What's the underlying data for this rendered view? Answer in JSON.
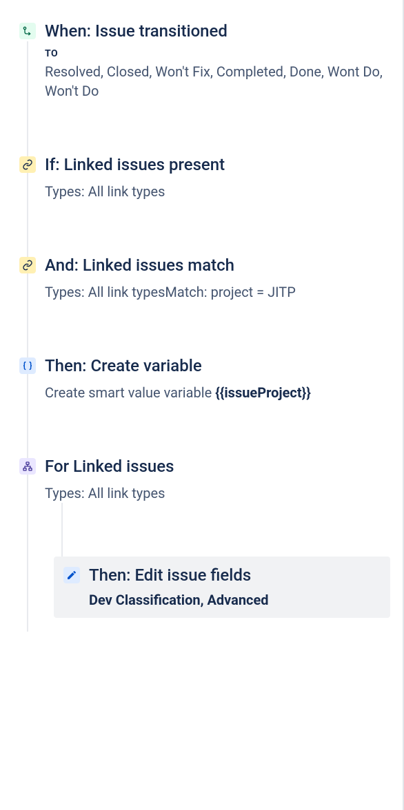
{
  "steps": [
    {
      "icon": "transition",
      "iconColor": "teal",
      "title": "When: Issue transitioned",
      "subtitleLabel": "TO",
      "description": "Resolved, Closed, Won't Fix, Completed, Done, Wont Do, Won't Do"
    },
    {
      "icon": "link",
      "iconColor": "yellow",
      "title": "If: Linked issues present",
      "description": "Types: All link types"
    },
    {
      "icon": "link",
      "iconColor": "yellow",
      "title": "And: Linked issues match",
      "description": "Types: All link typesMatch: project = JITP"
    },
    {
      "icon": "variable",
      "iconColor": "blue",
      "title": "Then: Create variable",
      "descriptionPrefix": "Create smart value variable ",
      "descriptionBold": "{{issueProject}}"
    },
    {
      "icon": "branch",
      "iconColor": "purple",
      "title": "For Linked issues",
      "description": "Types: All link types",
      "nested": {
        "icon": "edit",
        "iconColor": "blue",
        "title": "Then: Edit issue fields",
        "descriptionBold": "Dev Classification, Advanced"
      }
    }
  ]
}
